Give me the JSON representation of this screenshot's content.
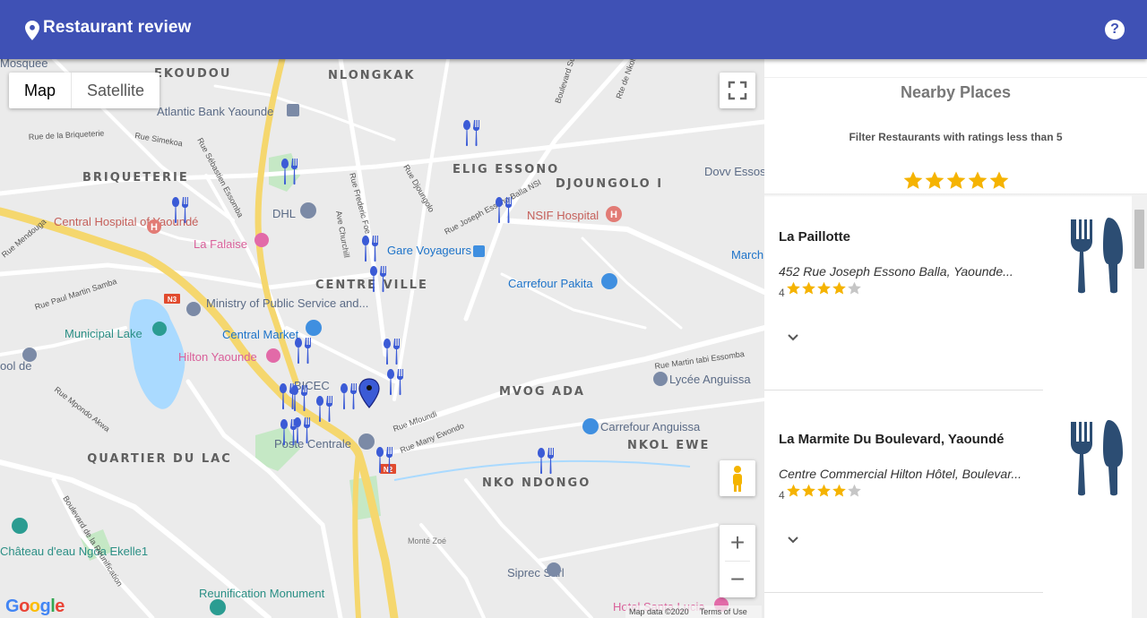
{
  "app": {
    "title": "Restaurant review",
    "help_label": "?"
  },
  "map": {
    "type_control": {
      "map_label": "Map",
      "satellite_label": "Satellite",
      "selected": "Map"
    },
    "zoom_in_label": "+",
    "zoom_out_label": "−",
    "google_logo": "Google",
    "attribution": {
      "data": "Map data ©2020",
      "terms": "Terms of Use"
    },
    "district_labels": [
      "NLONGKAK",
      "EKOUDOU",
      "BRIQUETERIE",
      "ELIG ESSONO",
      "DJOUNGOLO I",
      "CENTRE VILLE",
      "MVOG ADA",
      "NKOL EWE",
      "QUARTIER DU LAC",
      "NKO NDONGO"
    ],
    "place_labels": [
      "Atlantic Bank Yaounde",
      "DHL",
      "Central Hospital of Yaoundé",
      "La Falaise",
      "Gare Voyageurs",
      "NSIF Hospital",
      "Carrefour Pakita",
      "Ministry of Public Service and...",
      "Central Market",
      "Municipal Lake",
      "Hilton Yaounde",
      "Lycée Anguissa",
      "Carrefour Anguissa",
      "Poste Centrale",
      "Château d'eau Ngoa Ekelle1",
      "Reunification Monument",
      "Siprec Sarl",
      "Hotel Santa Lucia",
      "Dovv Essos",
      "March",
      "BICEC",
      "ool de",
      "Mosquee",
      "Monté Zoé"
    ],
    "street_labels": [
      "Rue de la Briqueterie",
      "Rue Simekoa",
      "Rue Sébastien Essomba",
      "Rue Paul Martin Samba",
      "Rue Mendouga",
      "Ave Churchill",
      "Rue Frederic Foe",
      "Rue Djoungolo",
      "Rue Joseph Essono Balla NSI",
      "Rue Martin tabi Essomba",
      "Rue Mfoundi",
      "Rue Many Ewondo",
      "Boulevard de la Reunification",
      "Rue Mpondo Akwa",
      "Rte de Nkolbisson",
      "Boulevard Sud Elig"
    ],
    "road_shields": [
      "N3",
      "N2"
    ]
  },
  "panel": {
    "heading": "Nearby Places",
    "filter_text": "Filter Restaurants with ratings less than 5",
    "filter_stars": 5,
    "restaurants": [
      {
        "name": "La Paillotte",
        "address": "452 Rue Joseph Essono Balla, Yaounde...",
        "rating": 4,
        "rating_label": "4",
        "icon": "utensils-icon"
      },
      {
        "name": "La Marmite Du Boulevard, Yaoundé",
        "address": "Centre Commercial Hilton Hôtel, Boulevar...",
        "rating": 4,
        "rating_label": "4",
        "icon": "utensils-icon"
      }
    ]
  },
  "colors": {
    "appbar": "#3f51b5",
    "star_gold": "#f5b301",
    "star_grey": "#c6c6c6",
    "marker_blue": "#3b5bd6",
    "utensil_dark": "#2c4d73"
  }
}
